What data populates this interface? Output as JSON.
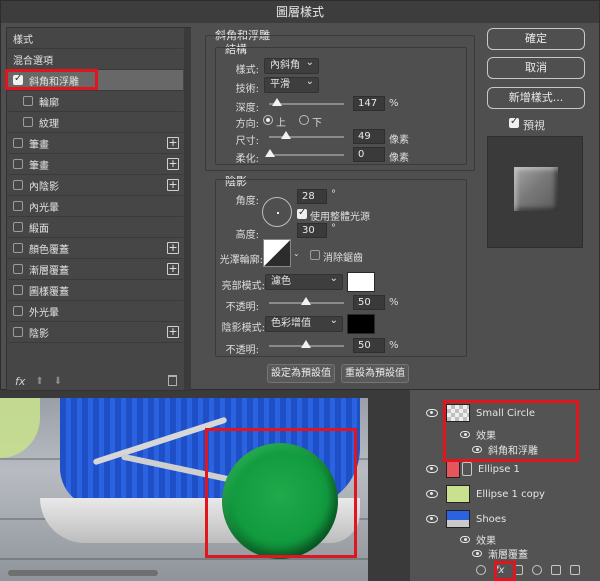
{
  "dialog": {
    "title": "圖層樣式",
    "style_list": {
      "items": [
        {
          "label": "樣式",
          "checkbox": false,
          "checked": false,
          "plus": false,
          "indent": false
        },
        {
          "label": "混合選項",
          "checkbox": false,
          "checked": false,
          "plus": false,
          "indent": false
        },
        {
          "label": "斜角和浮雕",
          "checkbox": true,
          "checked": true,
          "plus": false,
          "indent": false,
          "selected": true
        },
        {
          "label": "輪廓",
          "checkbox": true,
          "checked": false,
          "plus": false,
          "indent": true
        },
        {
          "label": "紋理",
          "checkbox": true,
          "checked": false,
          "plus": false,
          "indent": true
        },
        {
          "label": "筆畫",
          "checkbox": true,
          "checked": false,
          "plus": true,
          "indent": false
        },
        {
          "label": "筆畫",
          "checkbox": true,
          "checked": false,
          "plus": true,
          "indent": false
        },
        {
          "label": "內陰影",
          "checkbox": true,
          "checked": false,
          "plus": true,
          "indent": false
        },
        {
          "label": "內光暈",
          "checkbox": true,
          "checked": false,
          "plus": false,
          "indent": false
        },
        {
          "label": "緞面",
          "checkbox": true,
          "checked": false,
          "plus": false,
          "indent": false
        },
        {
          "label": "顏色覆蓋",
          "checkbox": true,
          "checked": false,
          "plus": true,
          "indent": false
        },
        {
          "label": "漸層覆蓋",
          "checkbox": true,
          "checked": false,
          "plus": true,
          "indent": false
        },
        {
          "label": "圖樣覆蓋",
          "checkbox": true,
          "checked": false,
          "plus": false,
          "indent": false
        },
        {
          "label": "外光暈",
          "checkbox": true,
          "checked": false,
          "plus": false,
          "indent": false
        },
        {
          "label": "陰影",
          "checkbox": true,
          "checked": false,
          "plus": true,
          "indent": false
        }
      ],
      "fx_label": "fx",
      "up_arrow": "⬆",
      "down_arrow": "⬇"
    },
    "bevel": {
      "section_title": "斜角和浮雕",
      "structure_title": "結構",
      "style_label": "樣式:",
      "style_value": "內斜角",
      "technique_label": "技術:",
      "technique_value": "平滑",
      "depth_label": "深度:",
      "depth_value": "147",
      "depth_unit": "%",
      "direction_label": "方向:",
      "direction_up": "上",
      "direction_down": "下",
      "direction_selected": "up",
      "size_label": "尺寸:",
      "size_value": "49",
      "size_unit": "像素",
      "soften_label": "柔化:",
      "soften_value": "0",
      "soften_unit": "像素"
    },
    "shading": {
      "title": "陰影",
      "angle_label": "角度:",
      "angle_value": "28",
      "angle_unit": "°",
      "global_light_label": "使用整體光源",
      "global_light_checked": true,
      "altitude_label": "高度:",
      "altitude_value": "30",
      "altitude_unit": "°",
      "gloss_label": "光澤輪廓:",
      "antialias_label": "消除鋸齒",
      "antialias_checked": false,
      "highlight_mode_label": "亮部模式:",
      "highlight_mode_value": "濾色",
      "highlight_color": "#ffffff",
      "highlight_opacity_label": "不透明:",
      "highlight_opacity_value": "50",
      "highlight_opacity_unit": "%",
      "shadow_mode_label": "陰影模式:",
      "shadow_mode_value": "色彩增值",
      "shadow_color": "#000000",
      "shadow_opacity_label": "不透明:",
      "shadow_opacity_value": "50",
      "shadow_opacity_unit": "%"
    },
    "buttons": {
      "make_default": "設定為預設值",
      "reset_default": "重設為預設值",
      "ok": "確定",
      "cancel": "取消",
      "new_style": "新增樣式...",
      "preview_label": "預視",
      "preview_checked": true
    }
  },
  "layers": {
    "items": [
      {
        "type": "layer",
        "name": "Small Circle",
        "thumb": "checker"
      },
      {
        "type": "effects",
        "label": "效果"
      },
      {
        "type": "effect",
        "label": "斜角和浮雕"
      },
      {
        "type": "layer",
        "name": "Ellipse 1",
        "thumb": "#e7555c"
      },
      {
        "type": "layer",
        "name": "Ellipse 1 copy",
        "thumb": "#c9e08f"
      },
      {
        "type": "layer",
        "name": "Shoes",
        "thumb": "photo"
      },
      {
        "type": "effects",
        "label": "效果"
      },
      {
        "type": "effect",
        "label": "漸層覆蓋"
      }
    ],
    "fx_label": "fx"
  },
  "colors": {
    "highlight_box": "#e2141d",
    "ball_green": "#129a3f"
  }
}
